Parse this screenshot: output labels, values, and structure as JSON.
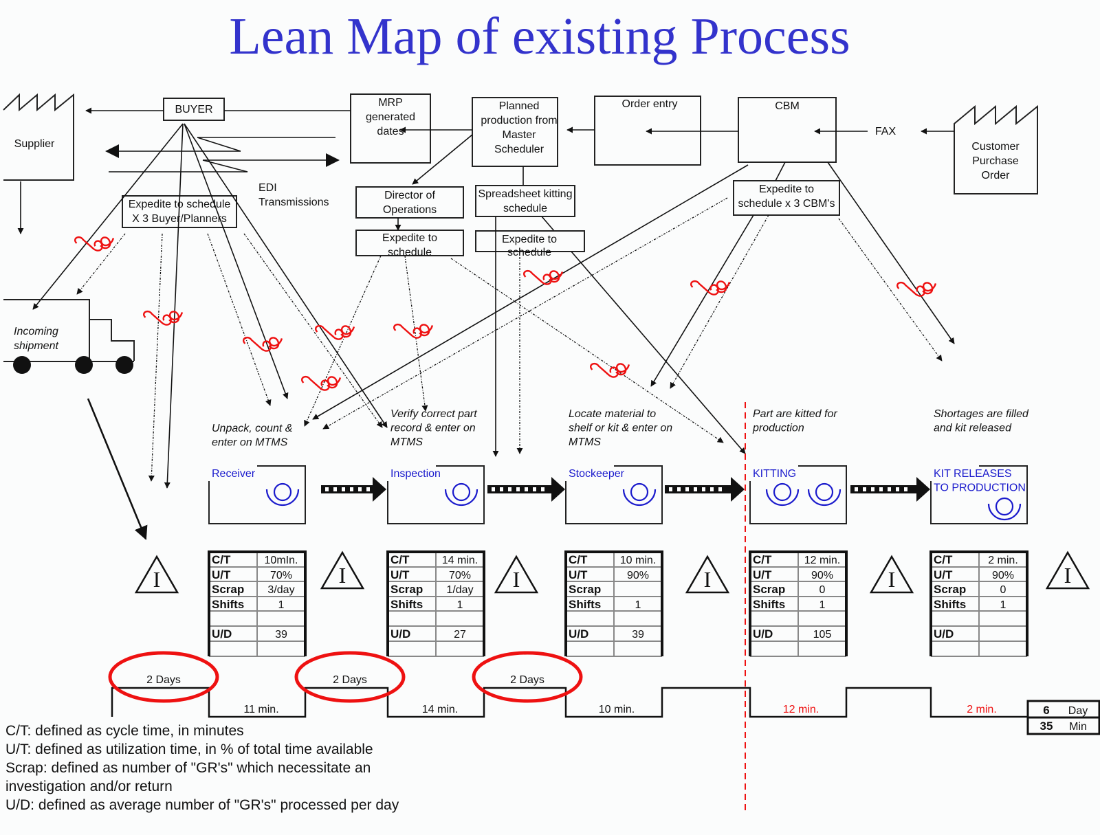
{
  "title": "Lean Map of existing Process",
  "supplier": {
    "label": "Supplier"
  },
  "customer": {
    "label_lines": [
      "Customer",
      "Purchase",
      "Order"
    ]
  },
  "info_boxes": {
    "buyer": "BUYER",
    "mrp": [
      "MRP",
      "generated",
      "dates"
    ],
    "planned": [
      "Planned",
      "production from",
      "Master",
      "Scheduler"
    ],
    "order_entry": "Order entry",
    "cbm": "CBM",
    "fax": "FAX",
    "edi": [
      "EDI",
      "Transmissions"
    ],
    "expedite_buyer": [
      "Expedite to  schedule",
      "X 3 Buyer/Planners"
    ],
    "director": [
      "Director of",
      "Operations"
    ],
    "expedite_director": [
      "Expedite to",
      "schedule"
    ],
    "spreadsheet": [
      "Spreadsheet kitting",
      "schedule"
    ],
    "expedite_spreadsheet": [
      "Expedite to",
      "schedule"
    ],
    "expedite_cbm": [
      "Expedite to",
      "schedule x 3 CBM's"
    ]
  },
  "truck": {
    "label_lines": [
      "Incoming",
      "shipment"
    ]
  },
  "processes": [
    {
      "name": "Receiver",
      "name_lines": [
        "Receiver"
      ],
      "operators": 1,
      "description": [
        "Unpack, count &",
        "enter on MTMS"
      ],
      "data": [
        [
          "C/T",
          "10mIn."
        ],
        [
          "U/T",
          "70%"
        ],
        [
          "Scrap",
          "3/day"
        ],
        [
          "Shifts",
          "1"
        ],
        [
          "",
          ""
        ],
        [
          "U/D",
          "39"
        ],
        [
          "",
          ""
        ]
      ],
      "timeline_wait": "2 Days",
      "timeline_process": "11 min."
    },
    {
      "name": "Inspection",
      "name_lines": [
        "Inspection"
      ],
      "operators": 1,
      "description": [
        "Verify correct part",
        "record & enter on",
        "MTMS"
      ],
      "data": [
        [
          "C/T",
          "14 min."
        ],
        [
          "U/T",
          "70%"
        ],
        [
          "Scrap",
          "1/day"
        ],
        [
          "Shifts",
          "1"
        ],
        [
          "",
          ""
        ],
        [
          "U/D",
          "27"
        ],
        [
          "",
          ""
        ]
      ],
      "timeline_wait": "2 Days",
      "timeline_process": "14 min."
    },
    {
      "name": "Stockeeper",
      "name_lines": [
        "Stockeeper"
      ],
      "operators": 1,
      "description": [
        "Locate material to",
        "shelf or kit & enter on",
        "MTMS"
      ],
      "data": [
        [
          "C/T",
          "10 min."
        ],
        [
          "U/T",
          "90%"
        ],
        [
          "Scrap",
          ""
        ],
        [
          "Shifts",
          "1"
        ],
        [
          "",
          ""
        ],
        [
          "U/D",
          "39"
        ],
        [
          "",
          ""
        ]
      ],
      "timeline_wait": "2 Days",
      "timeline_process": "10 min."
    },
    {
      "name": "KITTING",
      "name_lines": [
        "KITTING"
      ],
      "operators": 2,
      "description": [
        "Part are kitted for",
        "production"
      ],
      "data": [
        [
          "C/T",
          "12 min."
        ],
        [
          "U/T",
          "90%"
        ],
        [
          "Scrap",
          "0"
        ],
        [
          "Shifts",
          "1"
        ],
        [
          "",
          ""
        ],
        [
          "U/D",
          "105"
        ],
        [
          "",
          ""
        ]
      ],
      "timeline_wait": "",
      "timeline_process": "12 min."
    },
    {
      "name": "KIT RELEASES TO PRODUCTION",
      "name_lines": [
        "KIT RELEASES",
        "TO PRODUCTION"
      ],
      "operators": 1,
      "description": [
        "Shortages are filled",
        "and kit released"
      ],
      "data": [
        [
          "C/T",
          "2 min."
        ],
        [
          "U/T",
          "90%"
        ],
        [
          "Scrap",
          "0"
        ],
        [
          "Shifts",
          "1"
        ],
        [
          "",
          ""
        ],
        [
          "U/D",
          ""
        ],
        [
          "",
          ""
        ]
      ],
      "timeline_wait": "",
      "timeline_process": "2 min."
    }
  ],
  "inventory_symbol": "I",
  "totals": {
    "days_value": "6",
    "days_unit": "Day",
    "min_value": "35",
    "min_unit": "Min"
  },
  "legend": [
    "C/T: defined as cycle time, in minutes",
    "U/T: defined as utilization time, in % of total time available",
    "Scrap: defined as number of \"GR's\" which necessitate an",
    "investigation and/or return",
    "U/D: defined as average number of \"GR's\" processed per day"
  ],
  "colors": {
    "title": "#3333cc",
    "process_label": "#1a1acc",
    "highlight": "#ee1111"
  }
}
